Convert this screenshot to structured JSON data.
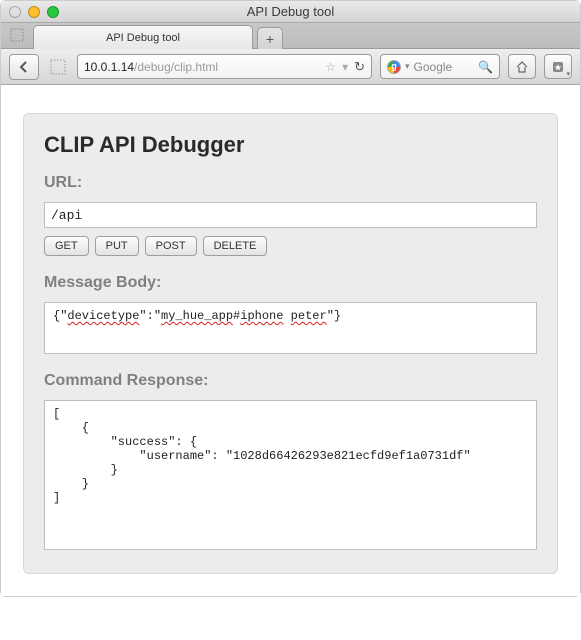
{
  "window": {
    "title": "API Debug tool",
    "traffic": {
      "close": "#ff5f57",
      "min": "#ffbd2e",
      "max": "#28c840"
    }
  },
  "tabs": {
    "active": {
      "label": "API Debug tool"
    }
  },
  "toolbar": {
    "address": {
      "host": "10.0.1.14",
      "path": "/debug/clip.html"
    },
    "search": {
      "placeholder": "Google"
    }
  },
  "panel": {
    "title": "CLIP API Debugger",
    "url": {
      "label": "URL:",
      "value": "/api"
    },
    "buttons": {
      "get": "GET",
      "put": "PUT",
      "post": "POST",
      "delete": "DELETE"
    },
    "body": {
      "label": "Message Body:",
      "value": "{\"devicetype\":\"my_hue_app#iphone peter\"}"
    },
    "response": {
      "label": "Command Response:",
      "value": "[\n    {\n        \"success\": {\n            \"username\": \"1028d66426293e821ecfd9ef1a0731df\"\n        }\n    }\n]"
    }
  }
}
